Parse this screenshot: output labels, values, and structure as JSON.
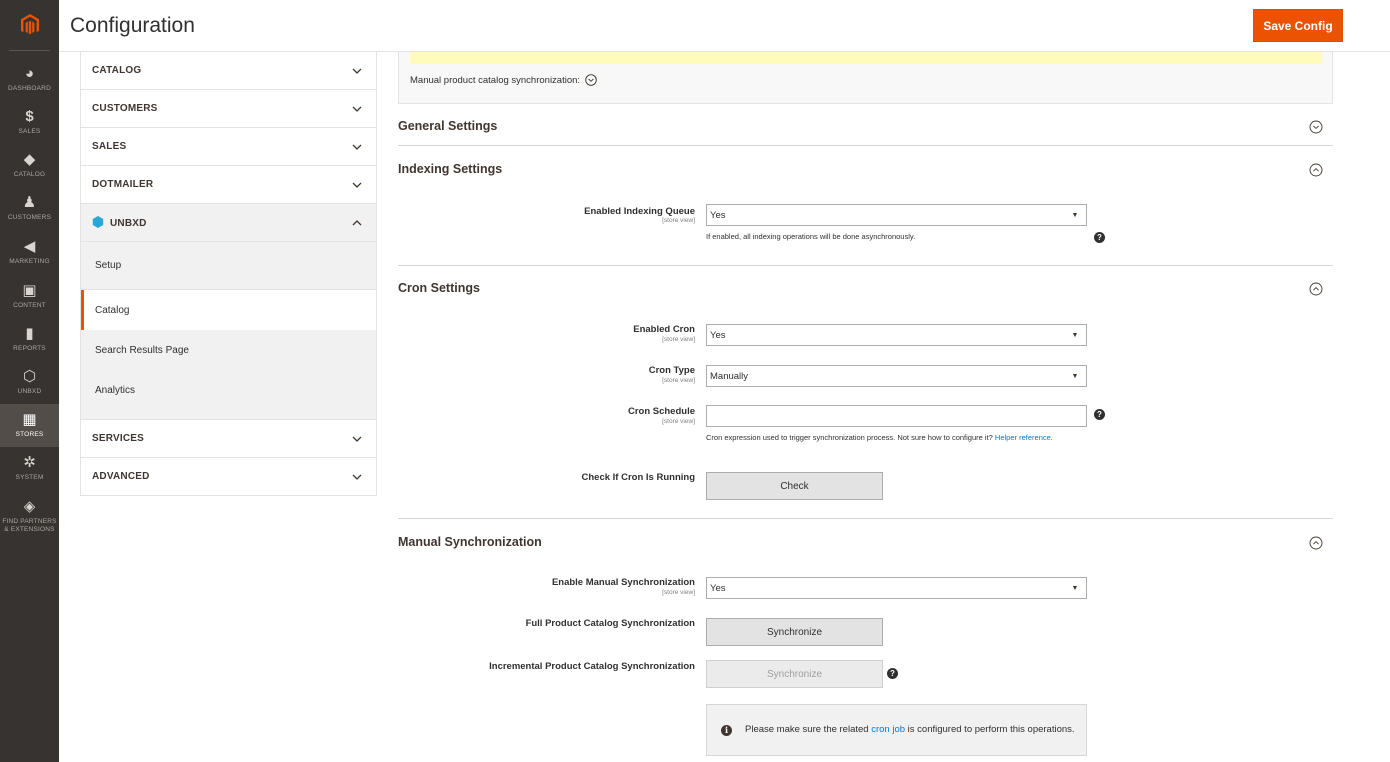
{
  "nav": {
    "items": [
      {
        "icon": "dashboard-icon",
        "glyph": "◕",
        "label": "DASHBOARD"
      },
      {
        "icon": "sales-icon",
        "glyph": "$",
        "label": "SALES"
      },
      {
        "icon": "catalog-icon",
        "glyph": "◆",
        "label": "CATALOG"
      },
      {
        "icon": "customers-icon",
        "glyph": "♟",
        "label": "CUSTOMERS"
      },
      {
        "icon": "marketing-icon",
        "glyph": "◀",
        "label": "MARKETING"
      },
      {
        "icon": "content-icon",
        "glyph": "▣",
        "label": "CONTENT"
      },
      {
        "icon": "reports-icon",
        "glyph": "▮",
        "label": "REPORTS"
      },
      {
        "icon": "unbxd-icon",
        "glyph": "⬡",
        "label": "UNBXD"
      },
      {
        "icon": "stores-icon",
        "glyph": "▦",
        "label": "STORES"
      },
      {
        "icon": "system-icon",
        "glyph": "✲",
        "label": "SYSTEM"
      },
      {
        "icon": "partners-icon",
        "glyph": "◈",
        "label": "FIND PARTNERS & EXTENSIONS"
      }
    ]
  },
  "header": {
    "title": "Configuration",
    "save_label": "Save Config",
    "accent": "#eb5202"
  },
  "tabs": {
    "catalog": "CATALOG",
    "customers": "CUSTOMERS",
    "sales": "SALES",
    "dotmailer": "DOTMAILER",
    "unbxd": "UNBXD",
    "unbxd_items": [
      "Setup",
      "Catalog",
      "Search Results Page",
      "Analytics"
    ],
    "services": "SERVICES",
    "advanced": "ADVANCED"
  },
  "main": {
    "manual_sync_label": "Manual product catalog synchronization:",
    "general": {
      "title": "General Settings"
    },
    "indexing": {
      "title": "Indexing Settings",
      "queue_label": "Enabled Indexing Queue",
      "queue_scope": "[store view]",
      "queue_value": "Yes",
      "queue_note": "If enabled, all indexing operations will be done asynchronously."
    },
    "cron": {
      "title": "Cron Settings",
      "enabled_label": "Enabled Cron",
      "enabled_scope": "[store view]",
      "enabled_value": "Yes",
      "type_label": "Cron Type",
      "type_scope": "[store view]",
      "type_value": "Manually",
      "schedule_label": "Cron Schedule",
      "schedule_scope": "[store view]",
      "schedule_value": "",
      "schedule_note": "Cron expression used to trigger synchronization process. Not sure how to configure it?",
      "schedule_link": "Helper reference",
      "schedule_note_end": ".",
      "check_label": "Check If Cron Is Running",
      "check_button": "Check"
    },
    "manual": {
      "title": "Manual Synchronization",
      "enable_label": "Enable Manual Synchronization",
      "enable_scope": "[store view]",
      "enable_value": "Yes",
      "full_label": "Full Product Catalog Synchronization",
      "full_button": "Synchronize",
      "incremental_label": "Incremental Product Catalog Synchronization",
      "incremental_button": "Synchronize",
      "info_prefix": "Please make sure the related",
      "info_link": "cron job",
      "info_suffix": "is configured to perform this operations."
    }
  }
}
